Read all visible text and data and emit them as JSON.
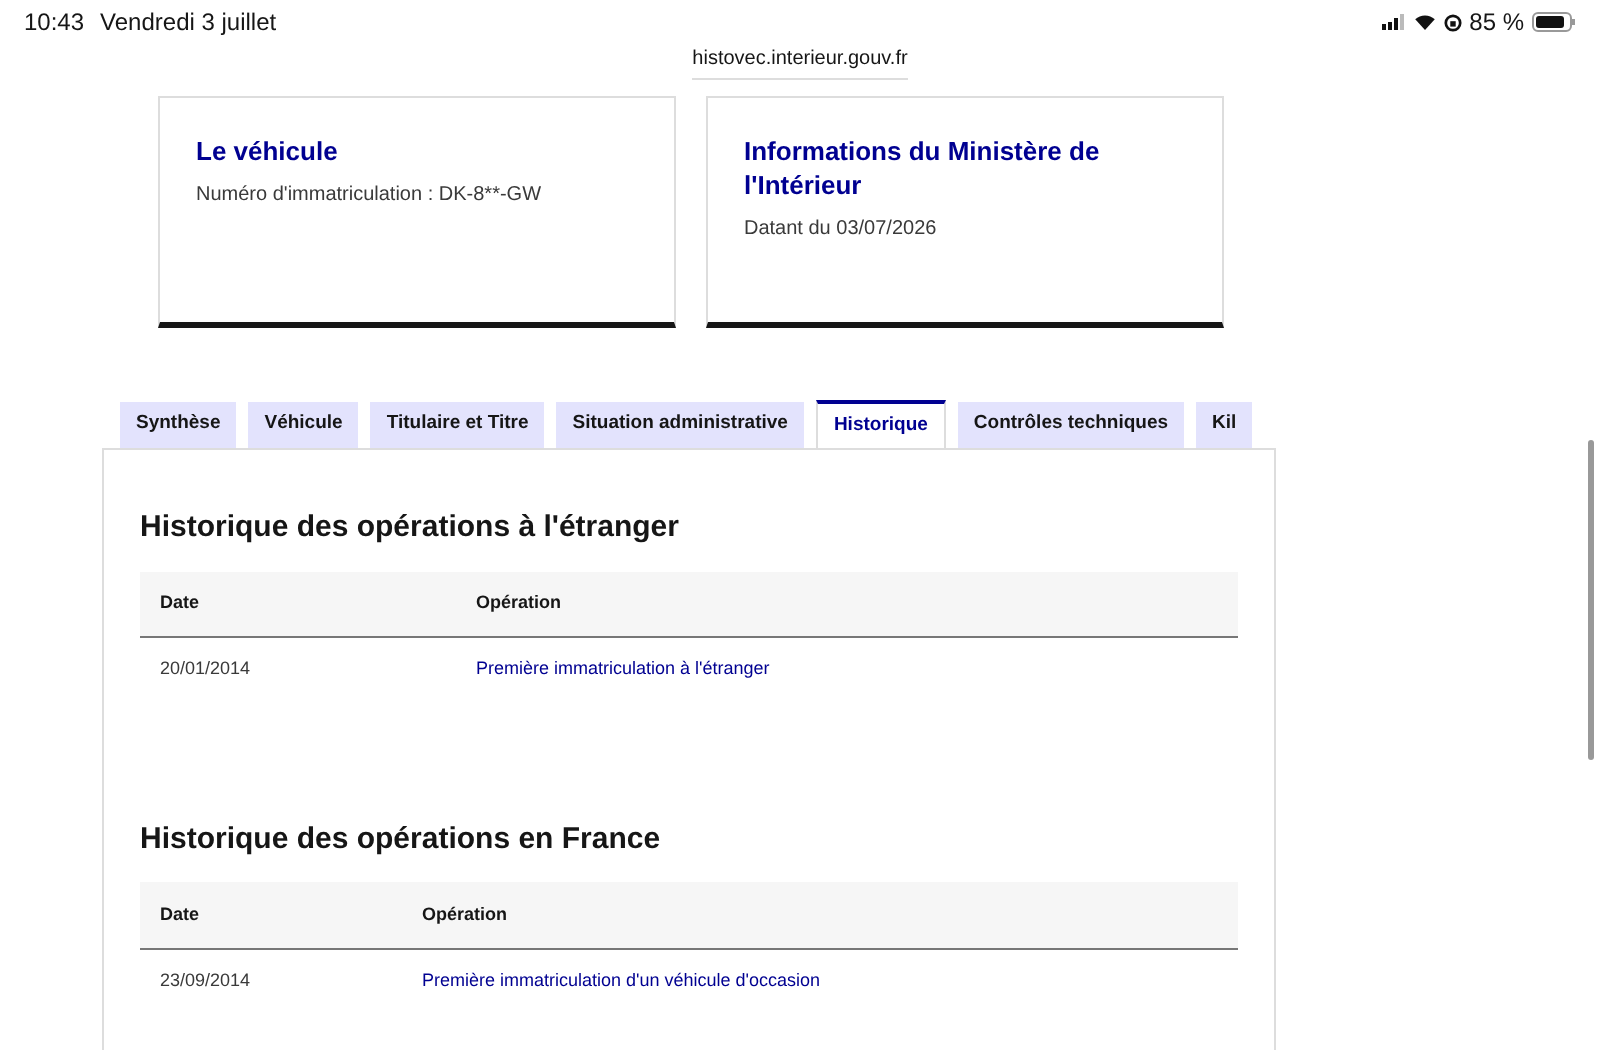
{
  "status_bar": {
    "time": "10:43",
    "date": "Vendredi 3 juillet",
    "battery": "85 %"
  },
  "url": "histovec.interieur.gouv.fr",
  "cards": [
    {
      "title": "Le véhicule",
      "text": "Numéro d'immatriculation : DK-8**-GW"
    },
    {
      "title": "Informations du Ministère de l'Intérieur",
      "text": "Datant du 03/07/2026"
    }
  ],
  "tabs": [
    {
      "label": "Synthèse",
      "selected": false
    },
    {
      "label": "Véhicule",
      "selected": false
    },
    {
      "label": "Titulaire et Titre",
      "selected": false
    },
    {
      "label": "Situation administrative",
      "selected": false
    },
    {
      "label": "Historique",
      "selected": true
    },
    {
      "label": "Contrôles techniques",
      "selected": false
    },
    {
      "label": "Kil",
      "selected": false
    }
  ],
  "sections": [
    {
      "title": "Historique des opérations à l'étranger",
      "columns": [
        "Date",
        "Opération"
      ],
      "rows": [
        [
          "20/01/2014",
          "Première immatriculation à l'étranger"
        ]
      ]
    },
    {
      "title": "Historique des opérations en France",
      "columns": [
        "Date",
        "Opération"
      ],
      "rows": [
        [
          "23/09/2014",
          "Première immatriculation d'un véhicule d'occasion"
        ]
      ]
    }
  ]
}
